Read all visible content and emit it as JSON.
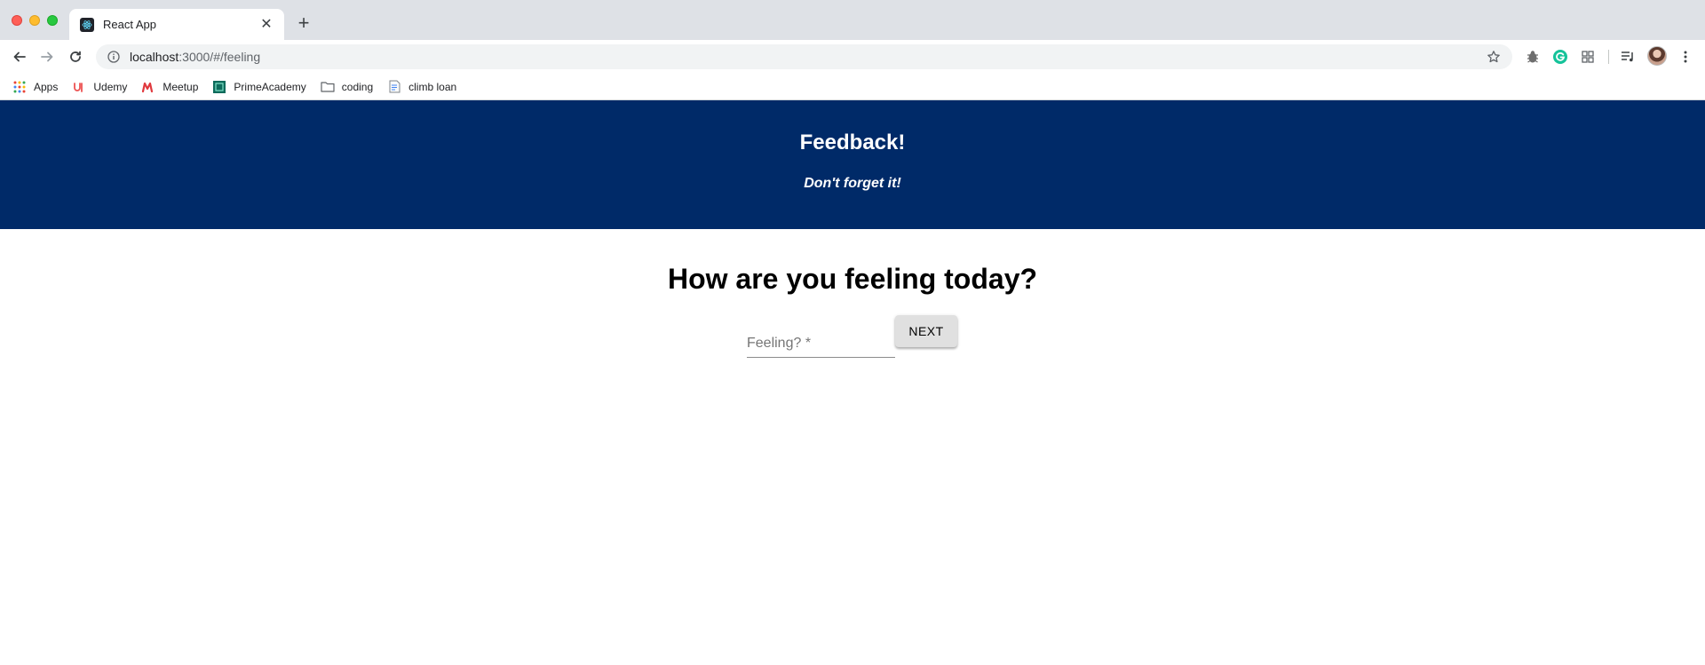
{
  "browser": {
    "tab": {
      "title": "React App",
      "close": "✕"
    },
    "new_tab": "+",
    "address": {
      "host": "localhost",
      "path": ":3000/#/feeling"
    },
    "bookmarks": [
      {
        "label": "Apps",
        "icon": "apps-grid-icon"
      },
      {
        "label": "Udemy",
        "icon": "udemy-icon"
      },
      {
        "label": "Meetup",
        "icon": "meetup-icon"
      },
      {
        "label": "PrimeAcademy",
        "icon": "prime-academy-icon"
      },
      {
        "label": "coding",
        "icon": "folder-icon"
      },
      {
        "label": "climb loan",
        "icon": "document-icon"
      }
    ],
    "icons": [
      "back-icon",
      "forward-icon",
      "reload-icon",
      "info-icon",
      "star-icon",
      "bug-extension-icon",
      "grammarly-icon",
      "extension-grid-icon",
      "media-queue-icon",
      "menu-dots-icon"
    ]
  },
  "page": {
    "header": {
      "title": "Feedback!",
      "subtitle": "Don't forget it!"
    },
    "question": "How are you feeling today?",
    "feeling_field": {
      "label": "Feeling? *",
      "value": ""
    },
    "next_button": "NEXT"
  },
  "colors": {
    "header_bg": "#002a68",
    "button_bg": "#e0e0e0",
    "tabstrip_bg": "#dee1e6"
  }
}
